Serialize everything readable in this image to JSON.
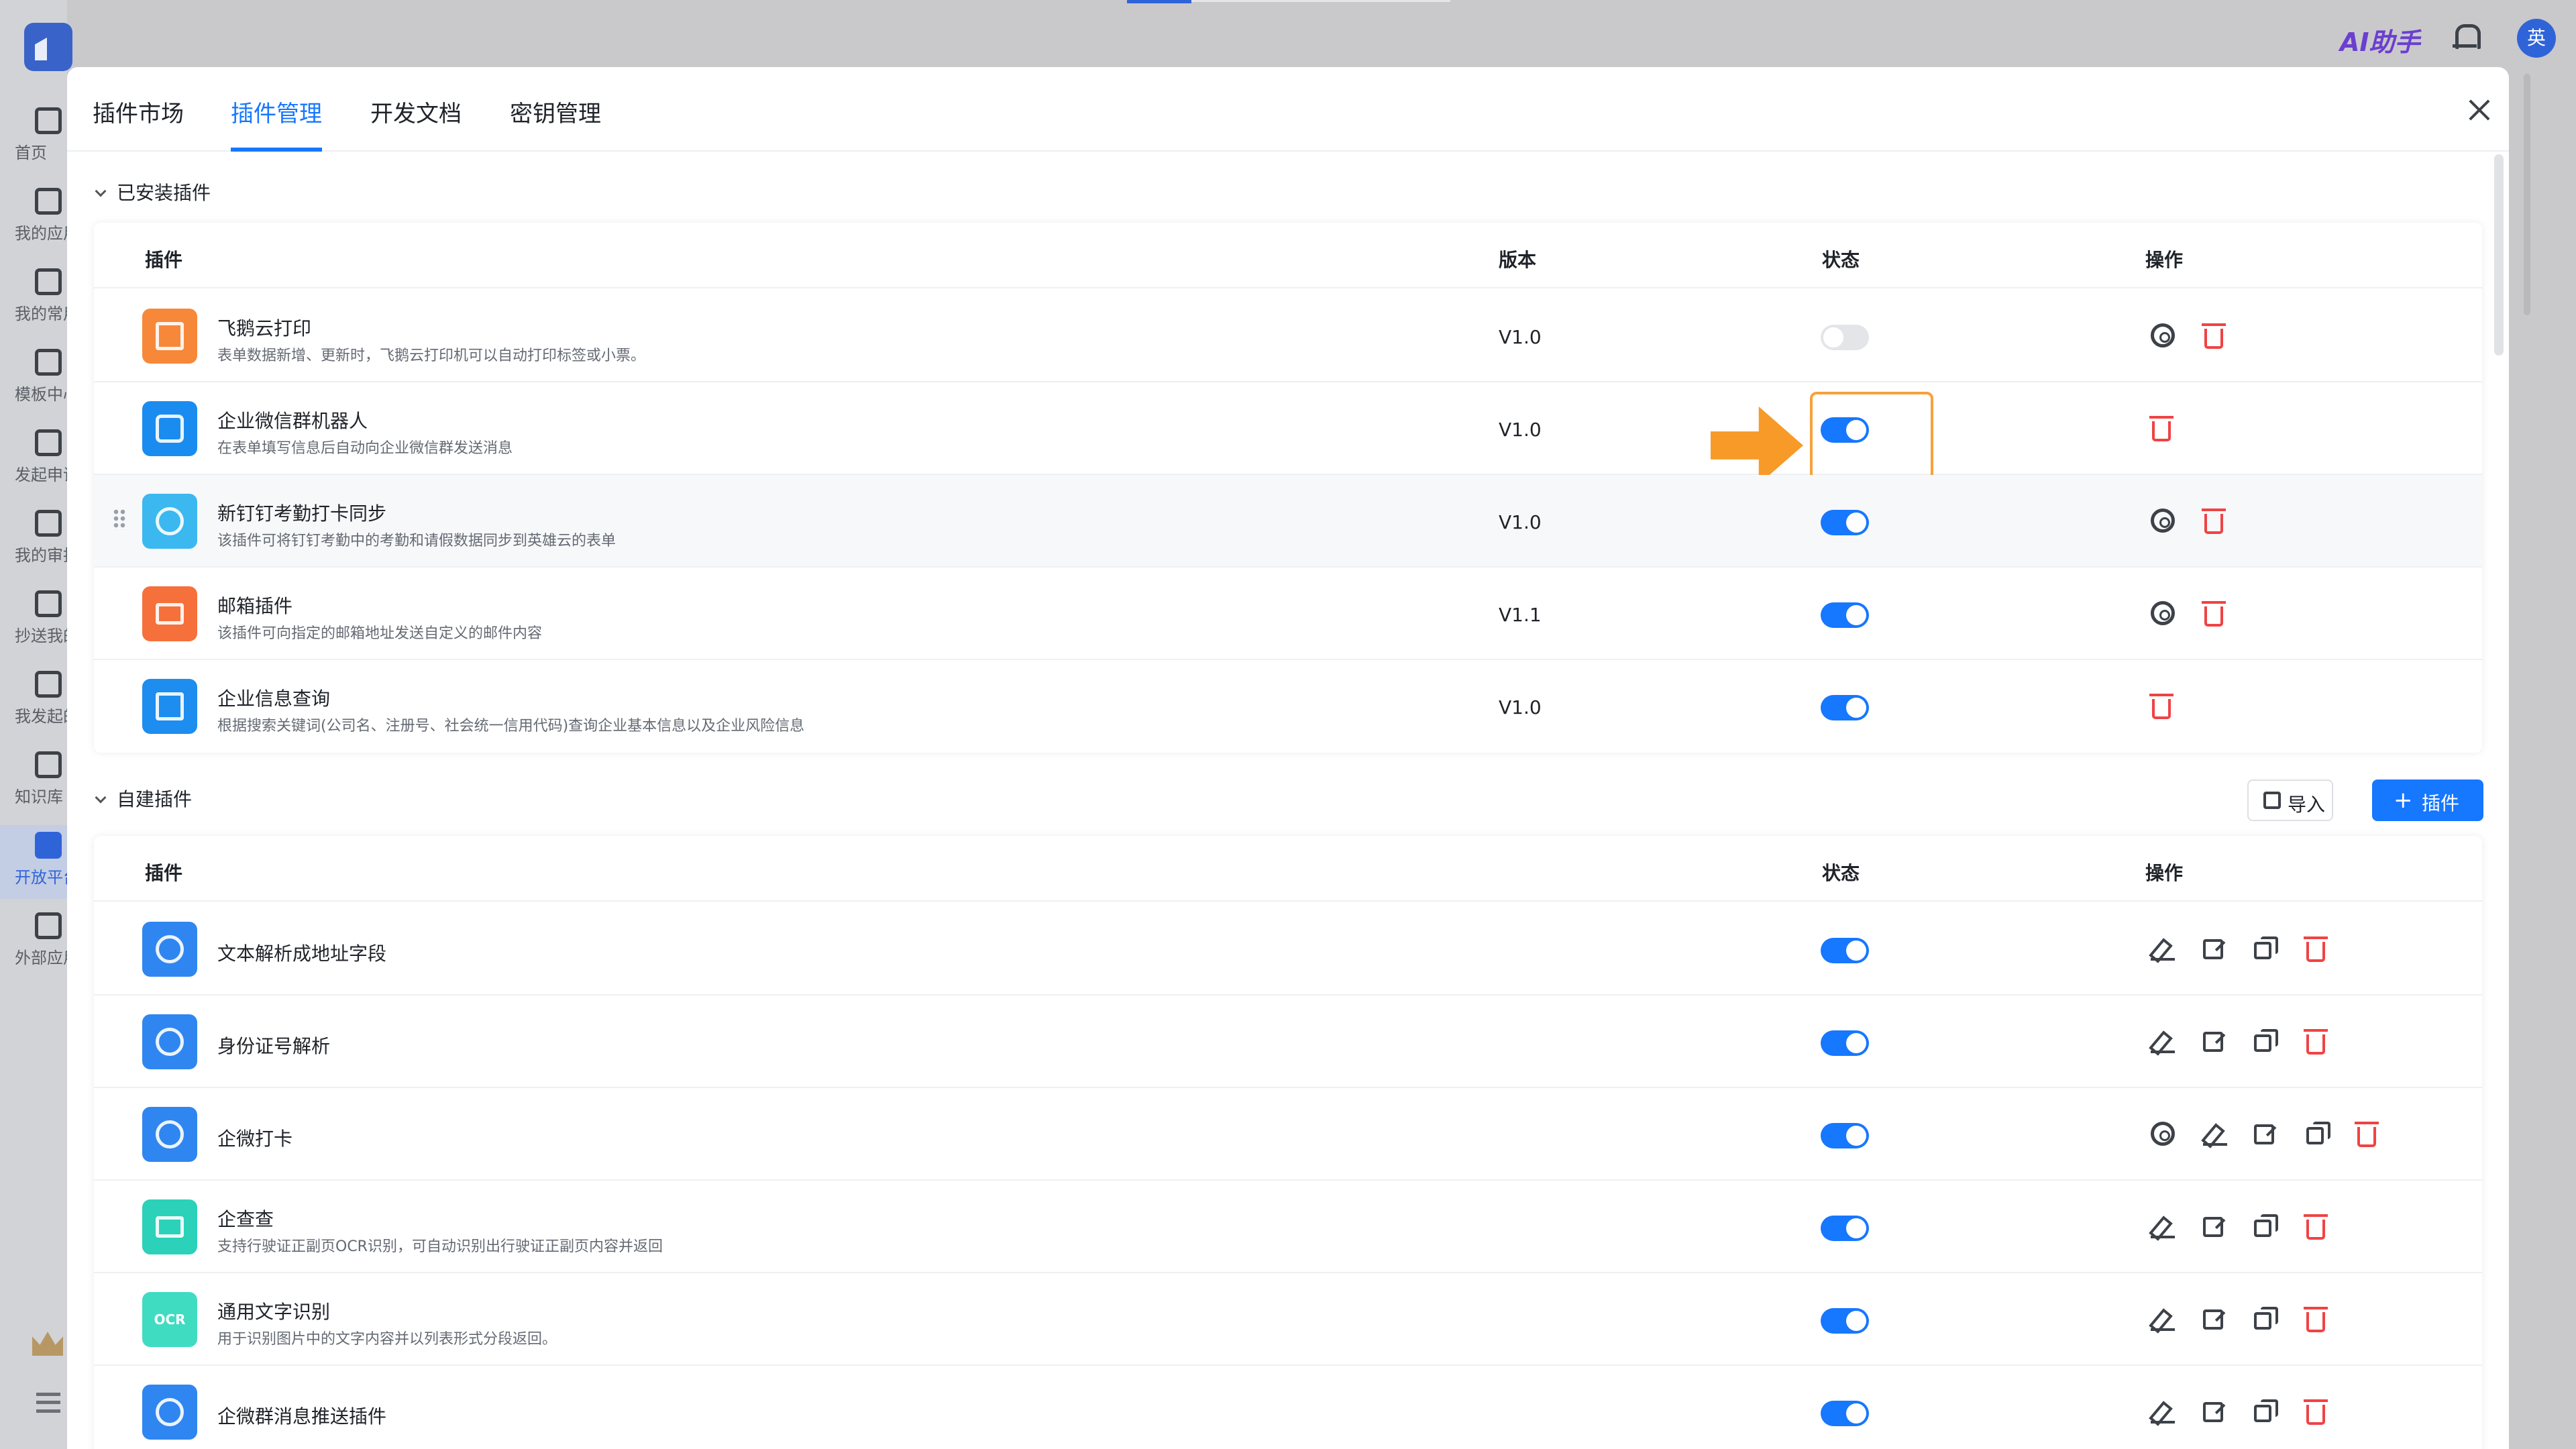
{
  "top_bar": {
    "ai_label": "AI助手",
    "avatar_text": "英"
  },
  "sidebar": {
    "items": [
      {
        "label": "首页"
      },
      {
        "label": "我的应用"
      },
      {
        "label": "我的常用"
      },
      {
        "label": "模板中心"
      },
      {
        "label": "发起申请"
      },
      {
        "label": "我的审批"
      },
      {
        "label": "抄送我的"
      },
      {
        "label": "我发起的"
      },
      {
        "label": "知识库"
      },
      {
        "label": "开放平台",
        "active": true
      },
      {
        "label": "外部应用"
      }
    ]
  },
  "modal": {
    "tabs": [
      {
        "label": "插件市场"
      },
      {
        "label": "插件管理",
        "active": true
      },
      {
        "label": "开发文档"
      },
      {
        "label": "密钥管理"
      }
    ],
    "installed": {
      "title": "已安装插件",
      "headers": {
        "plugin": "插件",
        "version": "版本",
        "status": "状态",
        "actions": "操作"
      },
      "rows": [
        {
          "name": "飞鹅云打印",
          "desc": "表单数据新增、更新时，飞鹅云打印机可以自动打印标签或小票。",
          "version": "V1.0",
          "enabled": false,
          "icon": "printer-icon"
        },
        {
          "name": "企业微信群机器人",
          "desc": "在表单填写信息后自动向企业微信群发送消息",
          "version": "V1.0",
          "enabled": true,
          "icon": "robot-icon"
        },
        {
          "name": "新钉钉考勤打卡同步",
          "desc": "该插件可将钉钉考勤中的考勤和请假数据同步到英雄云的表单",
          "version": "V1.0",
          "enabled": true,
          "icon": "clock-icon"
        },
        {
          "name": "邮箱插件",
          "desc": "该插件可向指定的邮箱地址发送自定义的邮件内容",
          "version": "V1.1",
          "enabled": true,
          "icon": "mail-icon"
        },
        {
          "name": "企业信息查询",
          "desc": "根据搜索关键词(公司名、注册号、社会统一信用代码)查询企业基本信息以及企业风险信息",
          "version": "V1.0",
          "enabled": true,
          "icon": "company-search-icon"
        }
      ]
    },
    "custom": {
      "title": "自建插件",
      "import_label": "导入",
      "add_label": "插件",
      "headers": {
        "plugin": "插件",
        "status": "状态",
        "actions": "操作"
      },
      "rows": [
        {
          "name": "文本解析成地址字段",
          "desc": "",
          "enabled": true
        },
        {
          "name": "身份证号解析",
          "desc": "",
          "enabled": true
        },
        {
          "name": "企微打卡",
          "desc": "",
          "enabled": true
        },
        {
          "name": "企查查",
          "desc": "支持行驶证正副页OCR识别，可自动识别出行驶证正副页内容并返回",
          "enabled": true
        },
        {
          "name": "通用文字识别",
          "desc": "用于识别图片中的文字内容并以列表形式分段返回。",
          "enabled": true,
          "icon_text": "OCR"
        },
        {
          "name": "企微群消息推送插件",
          "desc": "",
          "enabled": true
        }
      ]
    }
  },
  "colors": {
    "primary": "#1677ff",
    "danger": "#f04344",
    "highlight": "#f7a13a"
  }
}
